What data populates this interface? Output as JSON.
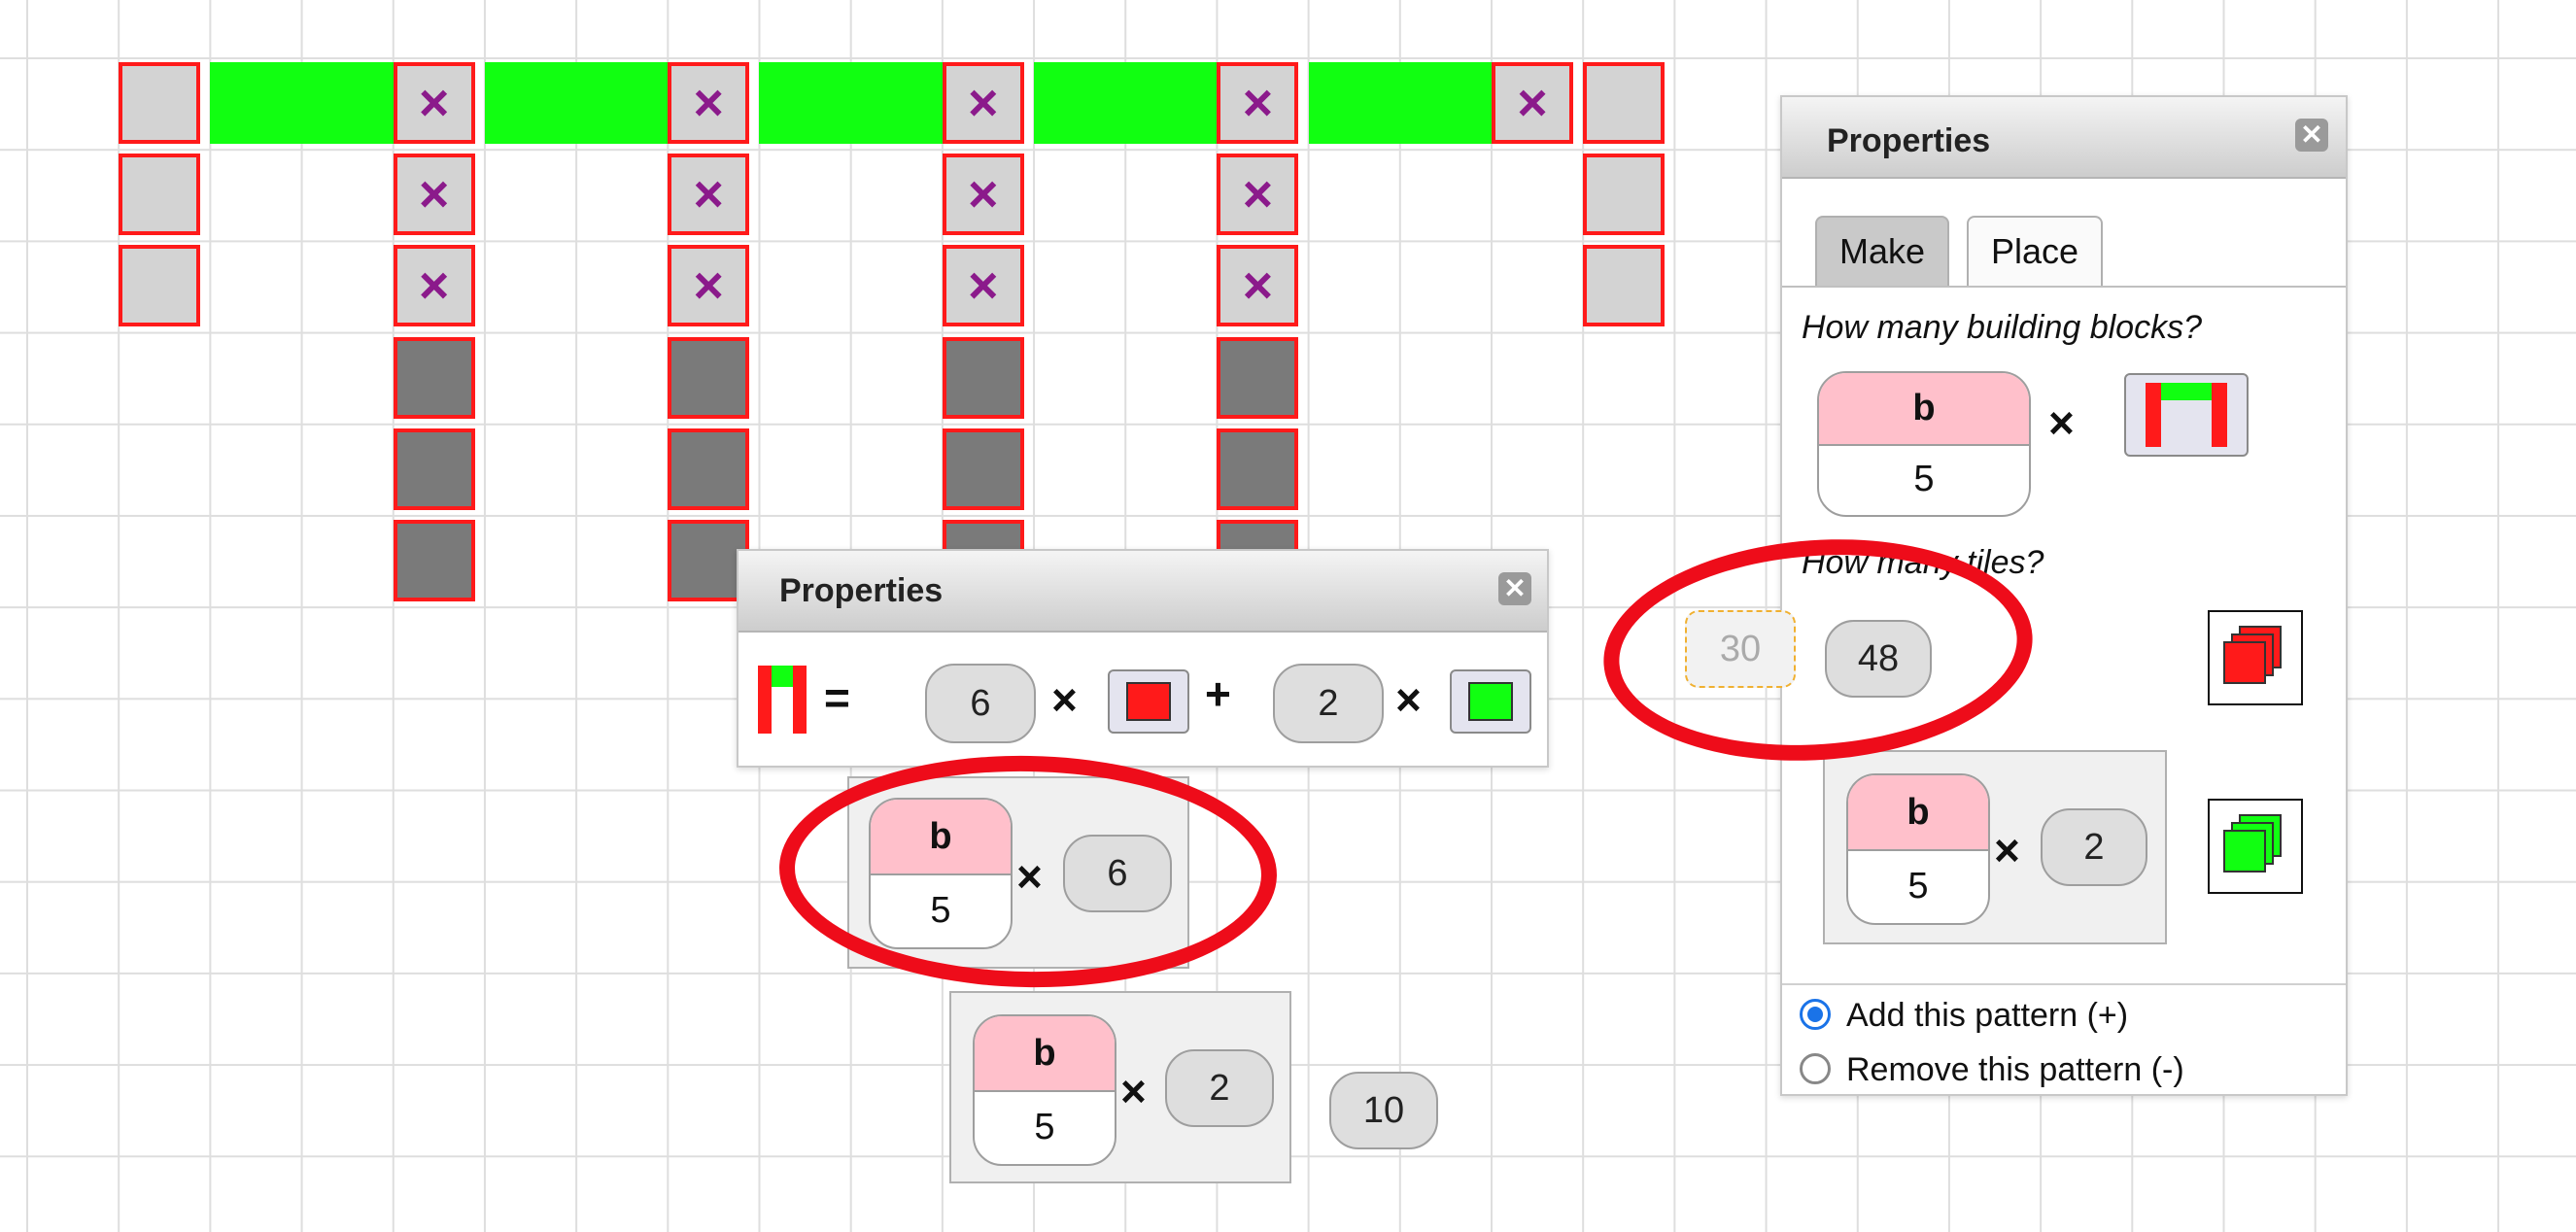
{
  "colors": {
    "accent_ring": "#ee0c1a",
    "tile_red": "#ff1a1a",
    "tile_green": "#11ff11",
    "tile_light": "#d3d3d3",
    "tile_dark": "#7a7a7a",
    "var_pink": "#ffc0cb",
    "x_mark": "#8b1a8b",
    "radio_blue": "#1a73e8"
  },
  "x_symbol": "×",
  "props_left": {
    "title": "Properties",
    "close_glyph": "✕",
    "formula": {
      "equals": "=",
      "red_count": "6",
      "times": "×",
      "plus": "+",
      "green_count": "2"
    }
  },
  "expr_red": {
    "var_name": "b",
    "var_value": "5",
    "times": "×",
    "multiplier": "6"
  },
  "expr_green": {
    "var_name": "b",
    "var_value": "5",
    "times": "×",
    "multiplier": "2",
    "result": "10"
  },
  "props_right": {
    "title": "Properties",
    "close_glyph": "✕",
    "tabs": [
      {
        "label": "Make",
        "active": true
      },
      {
        "label": "Place",
        "active": false
      }
    ],
    "q_blocks": "How many building blocks?",
    "block_var": {
      "name": "b",
      "value": "5"
    },
    "times": "×",
    "q_tiles": "How many tiles?",
    "ghost_value": "30",
    "tiles_value": "48",
    "green_expr": {
      "name": "b",
      "value": "5",
      "times": "×",
      "multiplier": "2"
    },
    "radios": [
      {
        "label": "Add this pattern (+)",
        "checked": true
      },
      {
        "label": "Remove this pattern (-)",
        "checked": false
      }
    ]
  }
}
